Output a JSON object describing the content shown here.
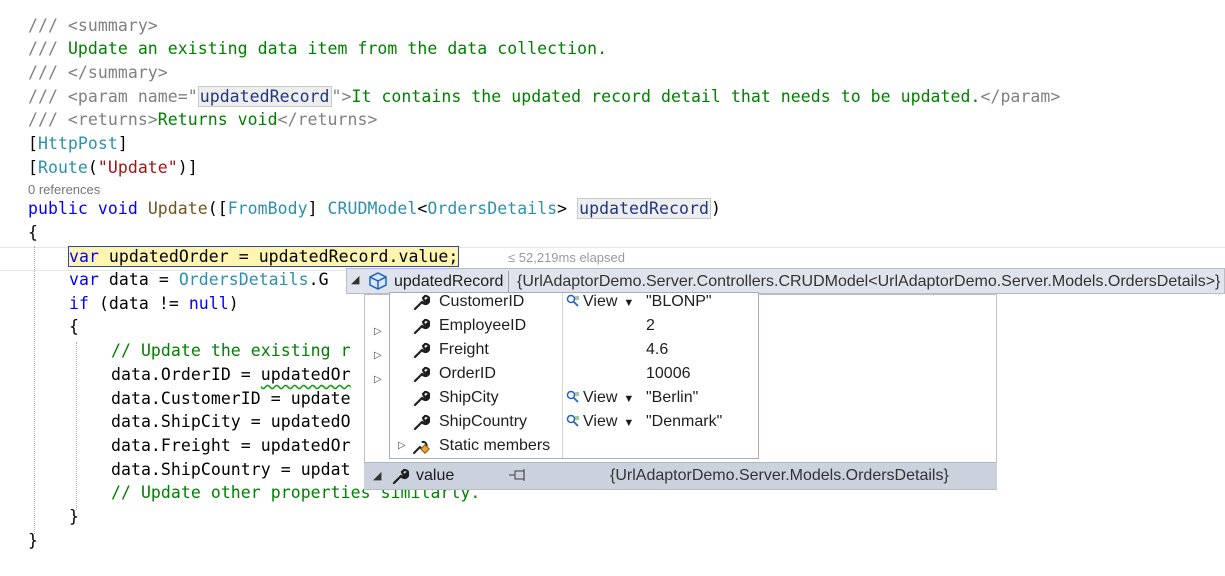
{
  "code": {
    "l1_comment": "/// <summary>",
    "l2_slashes": "/// ",
    "l2_text": "Update an existing data item from the data collection.",
    "l3_comment": "/// </summary>",
    "l4_a": "/// <param name=\"",
    "l4_param": "updatedRecord",
    "l4_b": "\">",
    "l4_text": "It contains the updated record detail that needs to be updated.",
    "l4_c": "</param>",
    "l5_a": "/// <returns>",
    "l5_text": "Returns void",
    "l5_c": "</returns>",
    "l6_open": "[",
    "l6_attr": "HttpPost",
    "l6_close": "]",
    "l7_open": "[",
    "l7_attr": "Route",
    "l7_paren": "(",
    "l7_str": "\"Update\"",
    "l7_close": ")]",
    "references": "0 references",
    "l8_public": "public",
    "l8_void": "void",
    "l8_method": "Update",
    "l8_p1": "([",
    "l8_frombody": "FromBody",
    "l8_p2": "] ",
    "l8_crud": "CRUDModel",
    "l8_lt": "<",
    "l8_orders": "OrdersDetails",
    "l8_gt": "> ",
    "l8_param": "updatedRecord",
    "l8_end": ")",
    "l9": "{",
    "l10_var": "var",
    "l10_rest": " updatedOrder = updatedRecord.value;",
    "elapsed": "≤ 52,219ms elapsed",
    "l11_var": "var",
    "l11_a": " data = ",
    "l11_type": "OrdersDetails",
    "l11_b": ".G",
    "l12_if": "if",
    "l12_a": " (data != ",
    "l12_null": "null",
    "l12_b": ")",
    "l13": "{",
    "l14": "// Update the existing r",
    "l15_a": "data.OrderID = ",
    "l15_b": "updatedOr",
    "l16": "data.CustomerID = update",
    "l17": "data.ShipCity = updatedO",
    "l18": "data.Freight = updatedOr",
    "l19": "data.ShipCountry = updat",
    "l20": "// Update other properties similarly.",
    "l21": "}",
    "l22": "}"
  },
  "datatip": {
    "header_name": "updatedRecord",
    "header_value": "{UrlAdaptorDemo.Server.Controllers.CRUDModel<UrlAdaptorDemo.Server.Models.OrdersDetails>}",
    "properties": [
      {
        "name": "CustomerID",
        "view": "View",
        "value": "\"BLONP\""
      },
      {
        "name": "EmployeeID",
        "view": "",
        "value": "2"
      },
      {
        "name": "Freight",
        "view": "",
        "value": "4.6"
      },
      {
        "name": "OrderID",
        "view": "",
        "value": "10006"
      },
      {
        "name": "ShipCity",
        "view": "View",
        "value": "\"Berlin\""
      },
      {
        "name": "ShipCountry",
        "view": "View",
        "value": "\"Denmark\""
      },
      {
        "name": "Static members",
        "view": "",
        "value": ""
      }
    ],
    "value_row": {
      "name": "value",
      "value": "{UrlAdaptorDemo.Server.Models.OrdersDetails}"
    }
  }
}
